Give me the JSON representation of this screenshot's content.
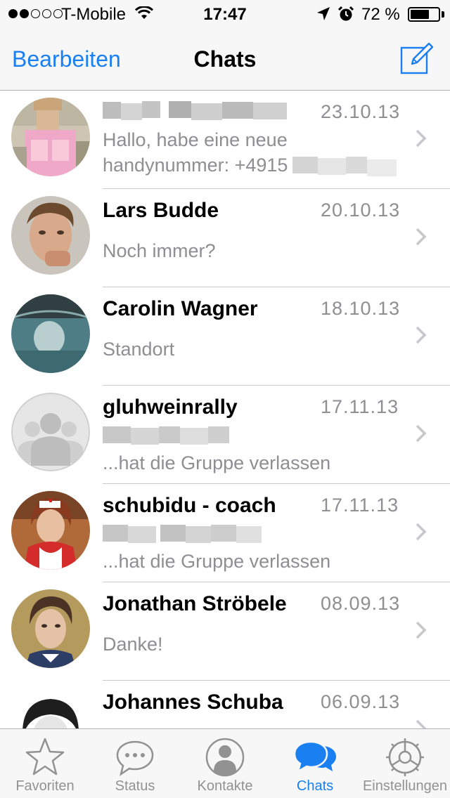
{
  "status_bar": {
    "carrier": "T-Mobile",
    "time": "17:47",
    "battery_percent": "72 %",
    "battery_level": 0.72,
    "signal_bars_filled": 2,
    "signal_bars_total": 5
  },
  "nav": {
    "edit_label": "Bearbeiten",
    "title": "Chats",
    "compose_icon": "compose-icon"
  },
  "chats": [
    {
      "name": "",
      "name_redacted": true,
      "date": "23.10.13",
      "message_line1": "Hallo, habe eine neue",
      "message_line2": "handynummer: +4915",
      "message_line2_partially_redacted": true
    },
    {
      "name": "Lars Budde",
      "date": "20.10.13",
      "message": "Noch immer?"
    },
    {
      "name": "Carolin Wagner",
      "date": "18.10.13",
      "message": "Standort"
    },
    {
      "name": "gluhweinrally",
      "date": "17.11.13",
      "message": "...hat die Gruppe verlassen",
      "sender_redacted": true,
      "group": true
    },
    {
      "name": "schubidu - coach",
      "date": "17.11.13",
      "message": "...hat die Gruppe verlassen",
      "sender_redacted": true
    },
    {
      "name": "Jonathan Ströbele",
      "date": "08.09.13",
      "message": "Danke!"
    },
    {
      "name": "Johannes Schuba",
      "date": "06.09.13",
      "message": ""
    }
  ],
  "tabs": [
    {
      "label": "Favoriten",
      "icon": "star-icon",
      "active": false
    },
    {
      "label": "Status",
      "icon": "speech-bubble-icon",
      "active": false
    },
    {
      "label": "Kontakte",
      "icon": "contact-icon",
      "active": false
    },
    {
      "label": "Chats",
      "icon": "chats-icon",
      "active": true
    },
    {
      "label": "Einstellungen",
      "icon": "gear-icon",
      "active": false
    }
  ],
  "colors": {
    "accent": "#1a7ff0",
    "secondary_text": "#8e8e93",
    "bar_background": "#f7f7f7",
    "separator": "#c8c7cc"
  }
}
